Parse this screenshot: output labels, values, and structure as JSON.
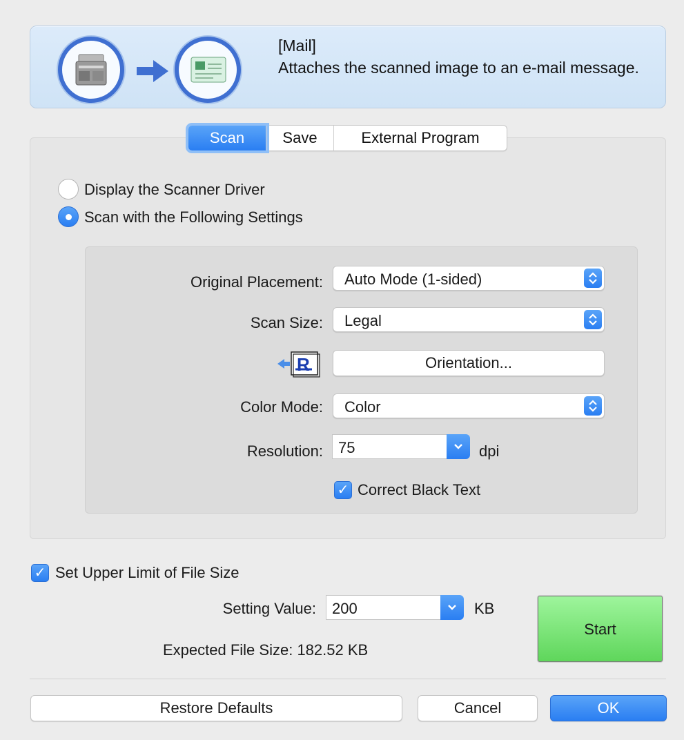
{
  "banner": {
    "mode_title": "[Mail]",
    "description": "Attaches the scanned image to an e-mail message.",
    "icons": [
      "scanner-icon",
      "arrow-right-icon",
      "mail-icon"
    ]
  },
  "tabs": [
    {
      "label": "Scan",
      "active": true
    },
    {
      "label": "Save",
      "active": false
    },
    {
      "label": "External Program",
      "active": false
    }
  ],
  "scan_options": {
    "display_driver": {
      "label": "Display the Scanner Driver",
      "selected": false
    },
    "following_settings": {
      "label": "Scan with the Following Settings",
      "selected": true
    }
  },
  "settings": {
    "original_placement": {
      "label": "Original Placement:",
      "value": "Auto Mode (1-sided)"
    },
    "scan_size": {
      "label": "Scan Size:",
      "value": "Legal"
    },
    "orientation": {
      "button_label": "Orientation...",
      "icon": "orientation-icon"
    },
    "color_mode": {
      "label": "Color Mode:",
      "value": "Color"
    },
    "resolution": {
      "label": "Resolution:",
      "value": "75",
      "unit": "dpi"
    },
    "correct_black_text": {
      "label": "Correct Black Text",
      "checked": true
    }
  },
  "file_size": {
    "limit": {
      "label": "Set Upper Limit of File Size",
      "checked": true
    },
    "setting_value": {
      "label": "Setting Value:",
      "value": "200",
      "unit": "KB"
    },
    "expected": {
      "label": "Expected File Size:",
      "value": "182.52 KB"
    }
  },
  "buttons": {
    "start": "Start",
    "restore_defaults": "Restore Defaults",
    "cancel": "Cancel",
    "ok": "OK"
  },
  "colors": {
    "accent_blue": "#2a7ef2",
    "banner_bg": "#d6e8f8",
    "start_green": "#6ee06a",
    "window_bg": "#ececec"
  }
}
